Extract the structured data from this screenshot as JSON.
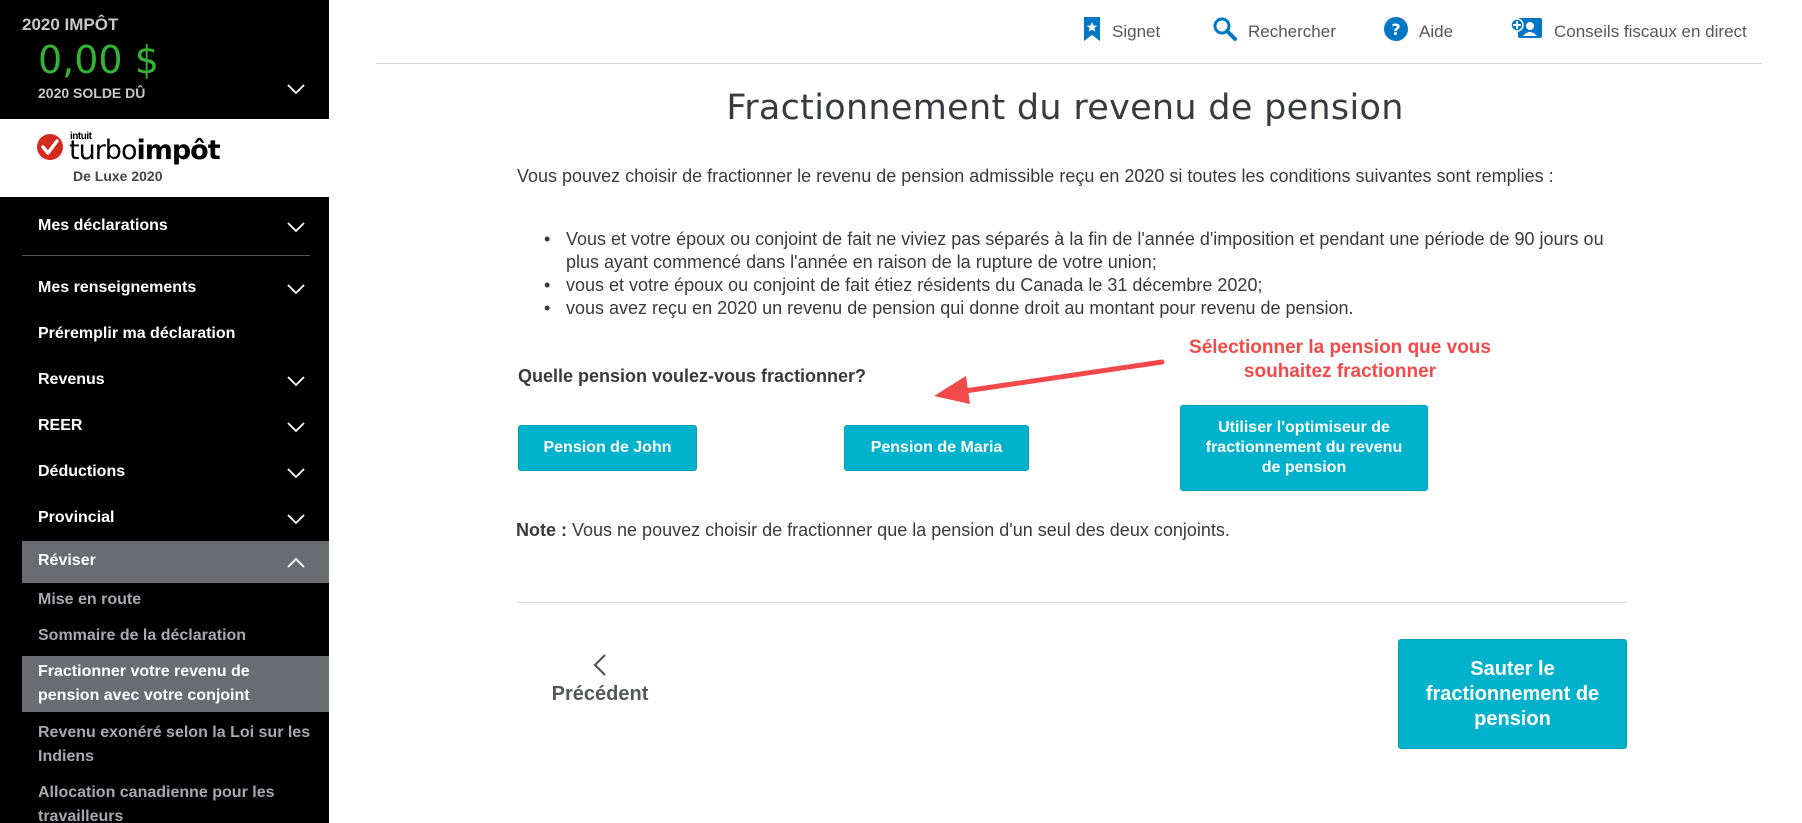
{
  "balance": {
    "year_label": "2020 IMPÔT",
    "amount": "0,00 $",
    "subtitle": "2020 SOLDE DÛ"
  },
  "logo": {
    "intuit": "intuit",
    "brand_light": "turbo",
    "brand_bold": "impôt",
    "edition": "De Luxe 2020"
  },
  "sidebar": {
    "items": [
      {
        "label": "Mes déclarations"
      },
      {
        "label": "Mes renseignements"
      },
      {
        "label": "Préremplir ma déclaration"
      },
      {
        "label": "Revenus"
      },
      {
        "label": "REER"
      },
      {
        "label": "Déductions"
      },
      {
        "label": "Provincial"
      },
      {
        "label": "Réviser"
      }
    ],
    "subitems": [
      {
        "label": "Mise en route"
      },
      {
        "label": "Sommaire de la déclaration"
      },
      {
        "label": "Fractionner votre revenu de pension avec votre conjoint"
      },
      {
        "label": "Revenu exonéré selon la Loi sur les Indiens"
      },
      {
        "label": "Allocation canadienne pour les travailleurs"
      }
    ]
  },
  "topbar": {
    "bookmark": "Signet",
    "search": "Rechercher",
    "help": "Aide",
    "live": "Conseils fiscaux en direct"
  },
  "main": {
    "title": "Fractionnement du revenu de pension",
    "intro": "Vous pouvez choisir de fractionner le revenu de pension admissible reçu en 2020 si toutes les conditions suivantes sont remplies :",
    "bullets": [
      "Vous et votre époux ou conjoint de fait ne viviez pas séparés à la fin de l'année d'imposition et pendant une période de 90 jours ou plus ayant commencé dans l'année en raison de la rupture de votre union;",
      "vous et votre époux ou conjoint de fait étiez résidents du Canada le 31 décembre 2020;",
      "vous avez reçu en 2020 un revenu de pension qui donne droit au montant pour revenu de pension."
    ],
    "question": "Quelle pension voulez-vous fractionner?",
    "annotation": "Sélectionner la pension que vous souhaitez fractionner",
    "btn_john": "Pension de John",
    "btn_maria": "Pension de Maria",
    "btn_optimizer": "Utiliser l'optimiseur de fractionnement du revenu de pension",
    "note_label": "Note :",
    "note_text": " Vous ne pouvez choisir de fractionner que la pension d'un seul des deux conjoints.",
    "prev": "Précédent",
    "skip": "Sauter le fractionnement de pension"
  },
  "colors": {
    "accent": "#00b2cc",
    "balance_green": "#34b233",
    "annotation_red": "#f24a4a",
    "sidebar_bg": "#000000",
    "sidebar_active": "#6b6c72"
  },
  "icons": [
    "chevron-down-icon",
    "chevron-up-icon",
    "bookmark-icon",
    "search-icon",
    "help-icon",
    "live-expert-icon",
    "checkmark-logo-icon",
    "chevron-left-icon",
    "annotation-arrow-icon"
  ]
}
